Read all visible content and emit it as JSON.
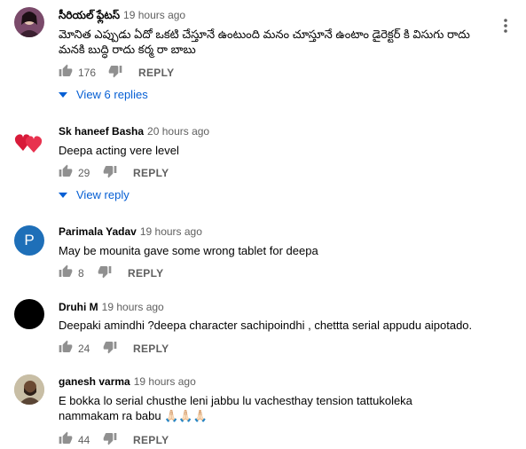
{
  "comments": [
    {
      "author": "సీరియల్ ఫ్లేటస్",
      "time": "19 hours ago",
      "text": "మోనిత ఎప్పుడు ఏదో ఒకటి చేస్తూనే ఉంటుంది మనం చూస్తూనే ఉంటాం డైరెక్టర్ కి విసుగు రాదు మనకి బుద్ధి రాదు కర్మ రా బాబు",
      "likes": "176",
      "reply": "REPLY",
      "view": "View 6 replies",
      "avatar": "avatar-image"
    },
    {
      "author": "Sk haneef Basha",
      "time": "20 hours ago",
      "text": "Deepa acting vere level",
      "likes": "29",
      "reply": "REPLY",
      "view": "View reply",
      "avatar": "hearts-avatar"
    },
    {
      "author": "Parimala Yadav",
      "time": "19 hours ago",
      "text": "May be mounita gave some wrong tablet for deepa",
      "likes": "8",
      "reply": "REPLY",
      "avatar": "P"
    },
    {
      "author": "Druhi M",
      "time": "19 hours ago",
      "text": "Deepaki amindhi ?deepa character sachipoindhi , chettta serial appudu aipotado.",
      "likes": "24",
      "reply": "REPLY",
      "avatar": "black-avatar"
    },
    {
      "author": "ganesh varma",
      "time": "19 hours ago",
      "text": "E bokka lo serial chusthe leni jabbu lu vachesthay tension tattukoleka nammakam ra babu 🙏🏻🙏🏻🙏🏻",
      "likes": "44",
      "reply": "REPLY",
      "avatar": "photo-avatar"
    }
  ],
  "colors": {
    "link": "#065fd4",
    "secondary": "#606060",
    "text": "#030303"
  }
}
